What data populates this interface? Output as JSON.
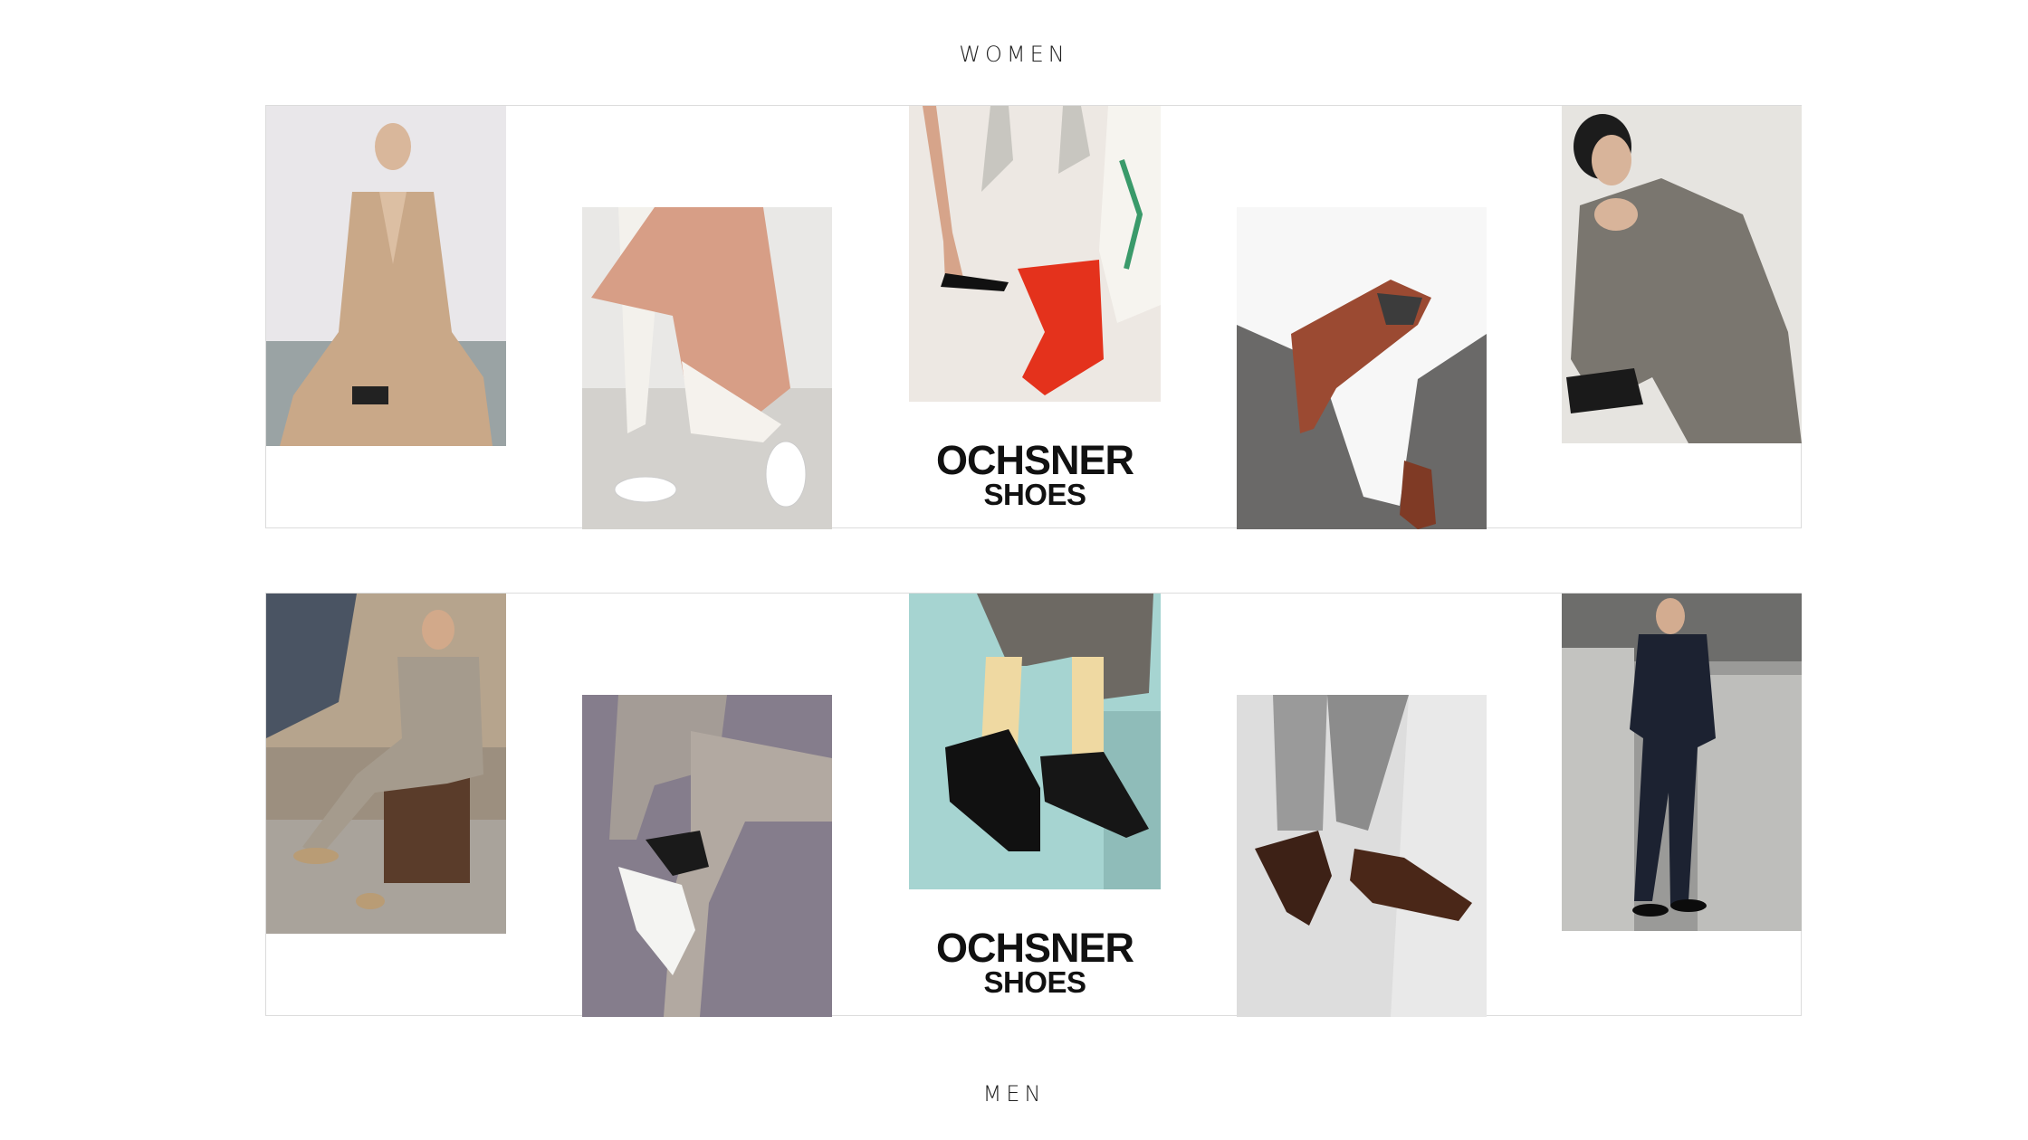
{
  "sections": {
    "women": {
      "title": "WOMEN",
      "logo": {
        "line1": "OCHSNER",
        "line2": "SHOES"
      }
    },
    "men": {
      "title": "MEN",
      "logo": {
        "line1": "OCHSNER",
        "line2": "SHOES"
      }
    }
  },
  "colors": {
    "background": "#ffffff",
    "frame_border": "#dcdcdc",
    "text": "#222222"
  }
}
